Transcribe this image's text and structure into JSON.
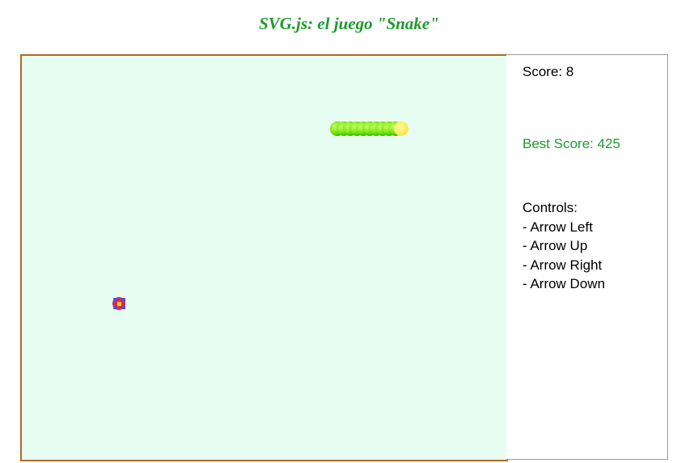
{
  "title": "SVG.js: el juego \"Snake\"",
  "score": {
    "label": "Score: 8",
    "value": 8
  },
  "best_score": {
    "label": "Best Score: 425",
    "value": 425
  },
  "controls": {
    "heading": "Controls:",
    "items": [
      "- Arrow Left",
      "- Arrow Up",
      "- Arrow Right",
      "- Arrow Down"
    ]
  },
  "colors": {
    "title": "#1f9a2e",
    "best_score": "#1f9a2e",
    "board_background": "#e8fdf1",
    "board_border": "#ad6d1d",
    "snake_head": "#f2ec4c",
    "snake_body_light": "#a8f04a",
    "snake_body_dark": "#2fb400",
    "food_red": "#e8253f",
    "food_blue": "#5c4ad9",
    "food_yellow": "#f5d020"
  },
  "icons": {
    "snake": "snake-icon",
    "food": "food-icon"
  }
}
